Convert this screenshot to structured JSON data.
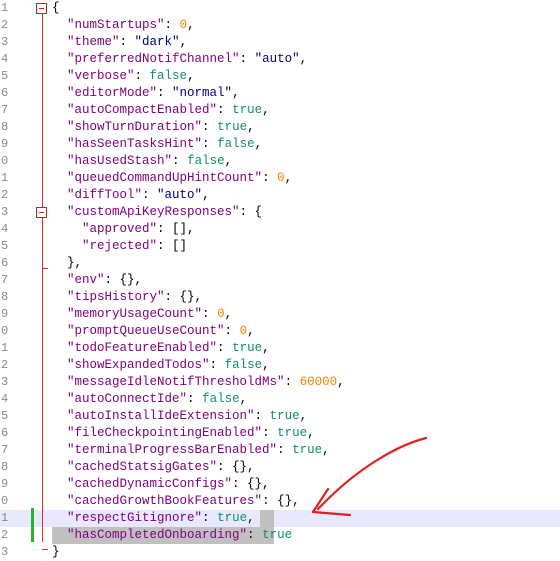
{
  "colors": {
    "key": "#800080",
    "string": "#000080",
    "number": "#ff8000",
    "boolean": "#0e8f6c",
    "fold_marker": "#e03030",
    "change_marker": "#28b428",
    "annotation_arrow": "#e02020"
  },
  "lines": [
    {
      "no": "1",
      "parts": [
        [
          "p",
          "{"
        ]
      ]
    },
    {
      "no": "2",
      "parts": [
        [
          "k",
          "\"numStartups\""
        ],
        [
          "p",
          ": "
        ],
        [
          "n",
          "0"
        ],
        [
          "p",
          ","
        ]
      ]
    },
    {
      "no": "3",
      "parts": [
        [
          "k",
          "\"theme\""
        ],
        [
          "p",
          ": "
        ],
        [
          "s",
          "\"dark\""
        ],
        [
          "p",
          ","
        ]
      ]
    },
    {
      "no": "4",
      "parts": [
        [
          "k",
          "\"preferredNotifChannel\""
        ],
        [
          "p",
          ": "
        ],
        [
          "s",
          "\"auto\""
        ],
        [
          "p",
          ","
        ]
      ]
    },
    {
      "no": "5",
      "parts": [
        [
          "k",
          "\"verbose\""
        ],
        [
          "p",
          ": "
        ],
        [
          "b",
          "false"
        ],
        [
          "p",
          ","
        ]
      ]
    },
    {
      "no": "6",
      "parts": [
        [
          "k",
          "\"editorMode\""
        ],
        [
          "p",
          ": "
        ],
        [
          "s",
          "\"normal\""
        ],
        [
          "p",
          ","
        ]
      ]
    },
    {
      "no": "7",
      "parts": [
        [
          "k",
          "\"autoCompactEnabled\""
        ],
        [
          "p",
          ": "
        ],
        [
          "b",
          "true"
        ],
        [
          "p",
          ","
        ]
      ]
    },
    {
      "no": "8",
      "parts": [
        [
          "k",
          "\"showTurnDuration\""
        ],
        [
          "p",
          ": "
        ],
        [
          "b",
          "true"
        ],
        [
          "p",
          ","
        ]
      ]
    },
    {
      "no": "9",
      "parts": [
        [
          "k",
          "\"hasSeenTasksHint\""
        ],
        [
          "p",
          ": "
        ],
        [
          "b",
          "false"
        ],
        [
          "p",
          ","
        ]
      ]
    },
    {
      "no": "0",
      "parts": [
        [
          "k",
          "\"hasUsedStash\""
        ],
        [
          "p",
          ": "
        ],
        [
          "b",
          "false"
        ],
        [
          "p",
          ","
        ]
      ]
    },
    {
      "no": "1",
      "parts": [
        [
          "k",
          "\"queuedCommandUpHintCount\""
        ],
        [
          "p",
          ": "
        ],
        [
          "n",
          "0"
        ],
        [
          "p",
          ","
        ]
      ]
    },
    {
      "no": "2",
      "parts": [
        [
          "k",
          "\"diffTool\""
        ],
        [
          "p",
          ": "
        ],
        [
          "s",
          "\"auto\""
        ],
        [
          "p",
          ","
        ]
      ]
    },
    {
      "no": "3",
      "parts": [
        [
          "k",
          "\"customApiKeyResponses\""
        ],
        [
          "p",
          ": {"
        ]
      ]
    },
    {
      "no": "4",
      "parts": [
        [
          "p",
          "  "
        ],
        [
          "k",
          "\"approved\""
        ],
        [
          "p",
          ": [],"
        ]
      ]
    },
    {
      "no": "5",
      "parts": [
        [
          "p",
          "  "
        ],
        [
          "k",
          "\"rejected\""
        ],
        [
          "p",
          ": []"
        ]
      ]
    },
    {
      "no": "6",
      "parts": [
        [
          "p",
          "},"
        ]
      ]
    },
    {
      "no": "7",
      "parts": [
        [
          "k",
          "\"env\""
        ],
        [
          "p",
          ": {},"
        ]
      ]
    },
    {
      "no": "8",
      "parts": [
        [
          "k",
          "\"tipsHistory\""
        ],
        [
          "p",
          ": {},"
        ]
      ]
    },
    {
      "no": "9",
      "parts": [
        [
          "k",
          "\"memoryUsageCount\""
        ],
        [
          "p",
          ": "
        ],
        [
          "n",
          "0"
        ],
        [
          "p",
          ","
        ]
      ]
    },
    {
      "no": "0",
      "parts": [
        [
          "k",
          "\"promptQueueUseCount\""
        ],
        [
          "p",
          ": "
        ],
        [
          "n",
          "0"
        ],
        [
          "p",
          ","
        ]
      ]
    },
    {
      "no": "1",
      "parts": [
        [
          "k",
          "\"todoFeatureEnabled\""
        ],
        [
          "p",
          ": "
        ],
        [
          "b",
          "true"
        ],
        [
          "p",
          ","
        ]
      ]
    },
    {
      "no": "2",
      "parts": [
        [
          "k",
          "\"showExpandedTodos\""
        ],
        [
          "p",
          ": "
        ],
        [
          "b",
          "false"
        ],
        [
          "p",
          ","
        ]
      ]
    },
    {
      "no": "3",
      "parts": [
        [
          "k",
          "\"messageIdleNotifThresholdMs\""
        ],
        [
          "p",
          ": "
        ],
        [
          "n",
          "60000"
        ],
        [
          "p",
          ","
        ]
      ]
    },
    {
      "no": "4",
      "parts": [
        [
          "k",
          "\"autoConnectIde\""
        ],
        [
          "p",
          ": "
        ],
        [
          "b",
          "false"
        ],
        [
          "p",
          ","
        ]
      ]
    },
    {
      "no": "5",
      "parts": [
        [
          "k",
          "\"autoInstallIdeExtension\""
        ],
        [
          "p",
          ": "
        ],
        [
          "b",
          "true"
        ],
        [
          "p",
          ","
        ]
      ]
    },
    {
      "no": "6",
      "parts": [
        [
          "k",
          "\"fileCheckpointingEnabled\""
        ],
        [
          "p",
          ": "
        ],
        [
          "b",
          "true"
        ],
        [
          "p",
          ","
        ]
      ]
    },
    {
      "no": "7",
      "parts": [
        [
          "k",
          "\"terminalProgressBarEnabled\""
        ],
        [
          "p",
          ": "
        ],
        [
          "b",
          "true"
        ],
        [
          "p",
          ","
        ]
      ]
    },
    {
      "no": "8",
      "parts": [
        [
          "k",
          "\"cachedStatsigGates\""
        ],
        [
          "p",
          ": {},"
        ]
      ]
    },
    {
      "no": "9",
      "parts": [
        [
          "k",
          "\"cachedDynamicConfigs\""
        ],
        [
          "p",
          ": {},"
        ]
      ]
    },
    {
      "no": "0",
      "parts": [
        [
          "k",
          "\"cachedGrowthBookFeatures\""
        ],
        [
          "p",
          ": {},"
        ]
      ]
    },
    {
      "no": "1",
      "parts": [
        [
          "k",
          "\"respectGitignore\""
        ],
        [
          "p",
          ": "
        ],
        [
          "b",
          "true"
        ],
        [
          "p",
          ","
        ]
      ]
    },
    {
      "no": "2",
      "parts": [
        [
          "k",
          "\"hasCompletedOnboarding\""
        ],
        [
          "p",
          ": "
        ],
        [
          "b",
          "true"
        ]
      ]
    },
    {
      "no": "3",
      "parts": [
        [
          "p",
          "}"
        ]
      ]
    }
  ]
}
